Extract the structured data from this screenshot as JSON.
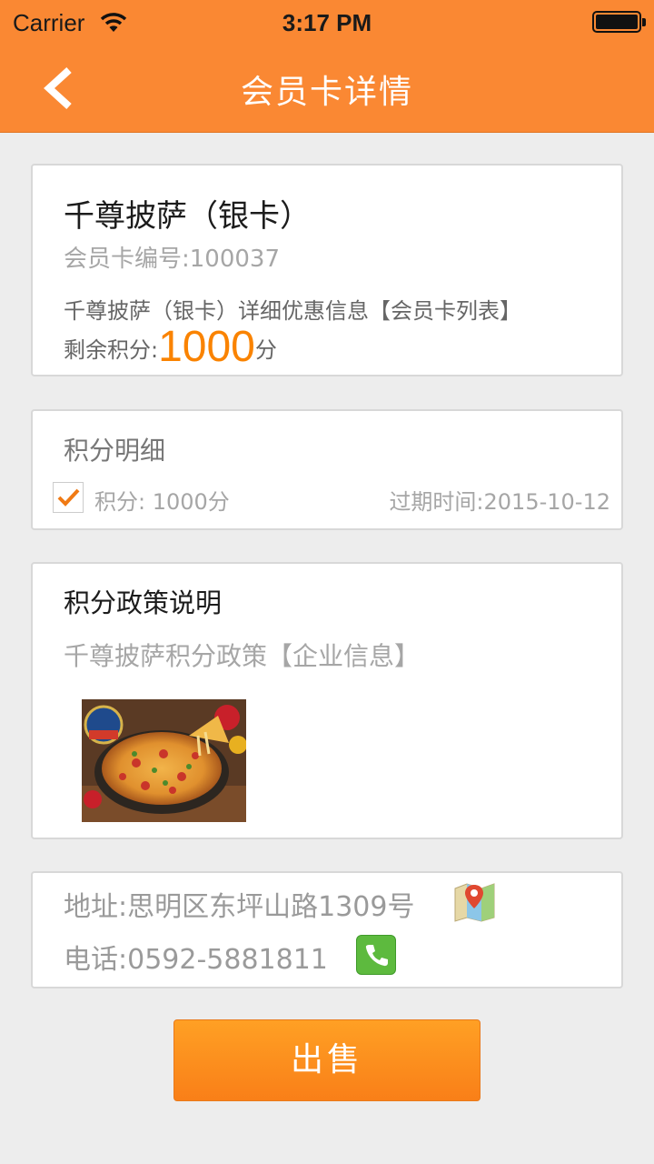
{
  "status_bar": {
    "carrier": "Carrier",
    "time": "3:17 PM"
  },
  "nav": {
    "title": "会员卡详情",
    "back_icon": "chevron-left-icon"
  },
  "card": {
    "name": "千尊披萨（银卡）",
    "number": "会员卡编号:100037",
    "detail_link": "千尊披萨（银卡）详细优惠信息【会员卡列表】",
    "points_label": "剩余积分:",
    "points_value": "1000",
    "points_unit": "分"
  },
  "points_detail": {
    "title": "积分明细",
    "record_points": "积分: 1000分",
    "record_expiry": "过期时间:2015-10-12"
  },
  "policy": {
    "title": "积分政策说明",
    "subtitle": "千尊披萨积分政策【企业信息】"
  },
  "contact": {
    "address": "地址:思明区东坪山路1309号",
    "phone": "电话:0592-5881811"
  },
  "actions": {
    "sell_label": "出售"
  },
  "colors": {
    "accent": "#fa8833",
    "points": "#fa8300",
    "phone_icon": "#5dba3e"
  }
}
